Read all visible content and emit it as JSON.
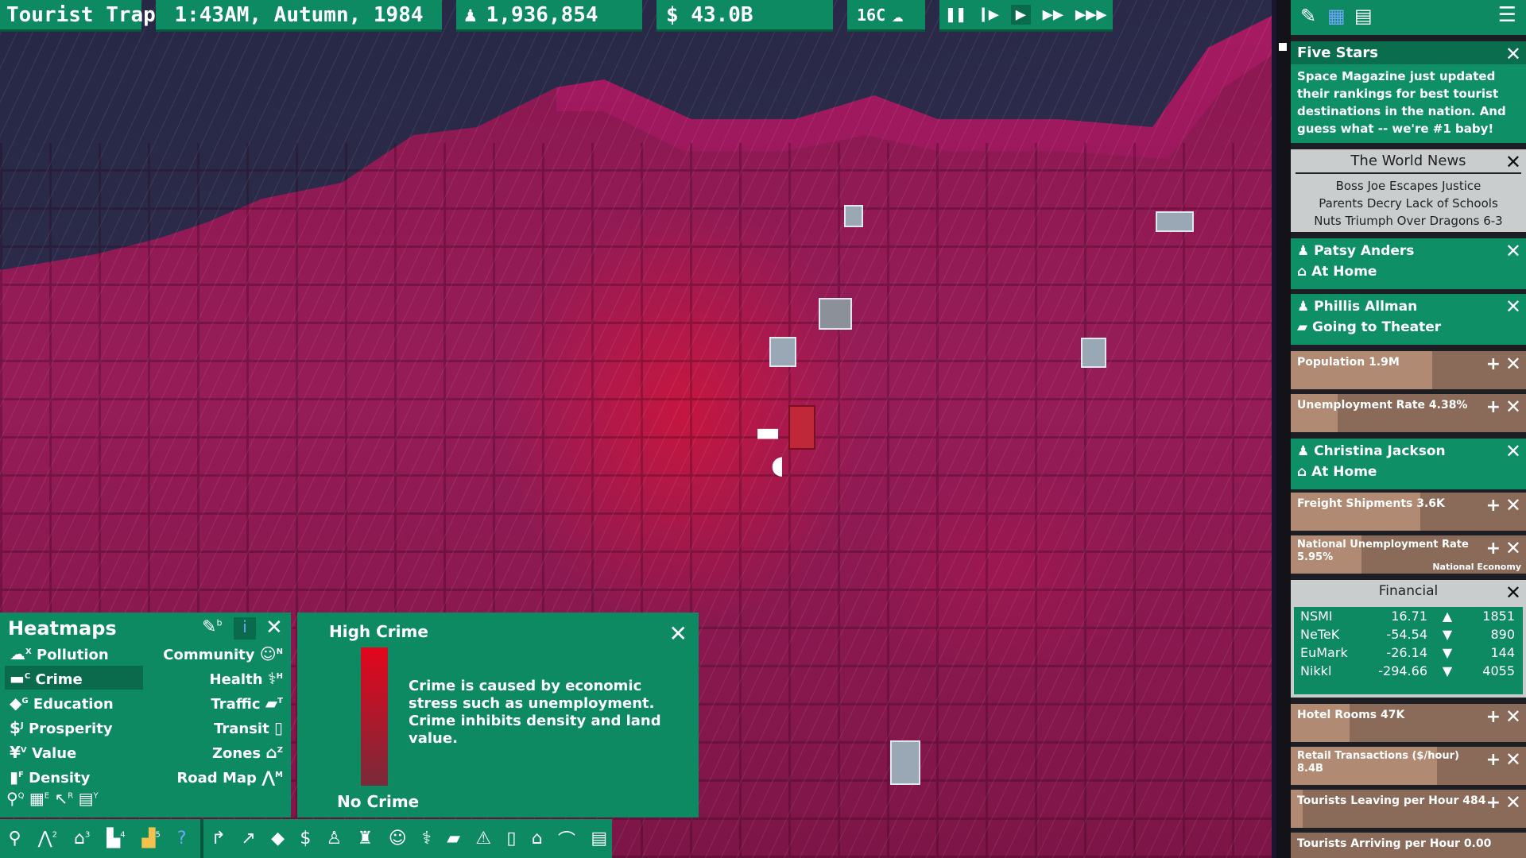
{
  "topbar": {
    "city_name": "Tourist Trap",
    "datetime": "1:43AM, Autumn, 1984",
    "population": "1,936,854",
    "money": "$ 43.0B",
    "temperature": "16C",
    "weather_icon": "rain-cloud-icon"
  },
  "speed_controls": [
    "pause",
    "slow",
    "normal",
    "fast",
    "fastest"
  ],
  "right_panel": {
    "five_stars": {
      "title": "Five Stars",
      "body": "Space Magazine just updated their rankings for best tourist destinations in the nation. And guess what -- we're #1 baby!"
    },
    "world_news": {
      "title": "The World News",
      "headlines": [
        "Boss Joe Escapes Justice",
        "Parents Decry Lack of Schools",
        "Nuts Triumph Over Dragons 6-3"
      ]
    },
    "person1": {
      "name": "Patsy Anders",
      "status": "At Home"
    },
    "person2": {
      "name": "Phillis Allman",
      "status": "Going to Theater"
    },
    "stat_population": {
      "label": "Population 1.9M",
      "fill": 0.6
    },
    "stat_unemployment": {
      "label": "Unemployment Rate 4.38%",
      "fill": 0.2
    },
    "person3": {
      "name": "Christina Jackson",
      "status": "At Home"
    },
    "stat_freight": {
      "label": "Freight Shipments 3.6K",
      "fill": 0.55
    },
    "stat_national_unemployment": {
      "label": "National Unemployment Rate 5.95%",
      "note": "National Economy",
      "fill": 0.3
    },
    "financial": {
      "title": "Financial",
      "rows": [
        {
          "name": "NSMI",
          "change": "16.71",
          "dir": "up",
          "value": "1851"
        },
        {
          "name": "NeTeK",
          "change": "-54.54",
          "dir": "down",
          "value": "890"
        },
        {
          "name": "EuMark",
          "change": "-26.14",
          "dir": "down",
          "value": "144"
        },
        {
          "name": "Nikkl",
          "change": "-294.66",
          "dir": "down",
          "value": "4055"
        }
      ]
    },
    "stat_hotel": {
      "label": "Hotel Rooms 47K",
      "fill": 0.25
    },
    "stat_retail": {
      "label": "Retail Transactions ($/hour) 8.4B",
      "fill": 0.62
    },
    "stat_tourists_leaving": {
      "label": "Tourists Leaving per Hour 484",
      "fill": 0.05
    },
    "stat_tourists_arriving": {
      "label": "Tourists Arriving per Hour 0.00",
      "fill": 0.0
    }
  },
  "heatmaps": {
    "title": "Heatmaps",
    "left": [
      {
        "key": "X",
        "label": "Pollution"
      },
      {
        "key": "C",
        "label": "Crime"
      },
      {
        "key": "G",
        "label": "Education"
      },
      {
        "key": "J",
        "label": "Prosperity"
      },
      {
        "key": "V",
        "label": "Value"
      },
      {
        "key": "F",
        "label": "Density"
      }
    ],
    "right": [
      {
        "key": "N",
        "label": "Community"
      },
      {
        "key": "H",
        "label": "Health"
      },
      {
        "key": "T",
        "label": "Traffic"
      },
      {
        "key": "",
        "label": "Transit"
      },
      {
        "key": "Z",
        "label": "Zones"
      },
      {
        "key": "M",
        "label": "Road Map"
      }
    ],
    "selected": "Crime",
    "pin_key": "b",
    "tool_keys": [
      "Q",
      "E",
      "R",
      "Y"
    ]
  },
  "legend": {
    "high_label": "High Crime",
    "low_label": "No Crime",
    "description": "Crime is caused by economic stress such as unemployment. Crime inhibits density and land value.",
    "high_color": "#e3061c",
    "low_color": "#7a2a3a"
  },
  "bottom_toolbar_keys": [
    "2",
    "3",
    "4",
    "5"
  ],
  "colors": {
    "panel_green": "#0e8a62",
    "heat_red": "#d61437",
    "map_magenta": "#8a1850"
  }
}
